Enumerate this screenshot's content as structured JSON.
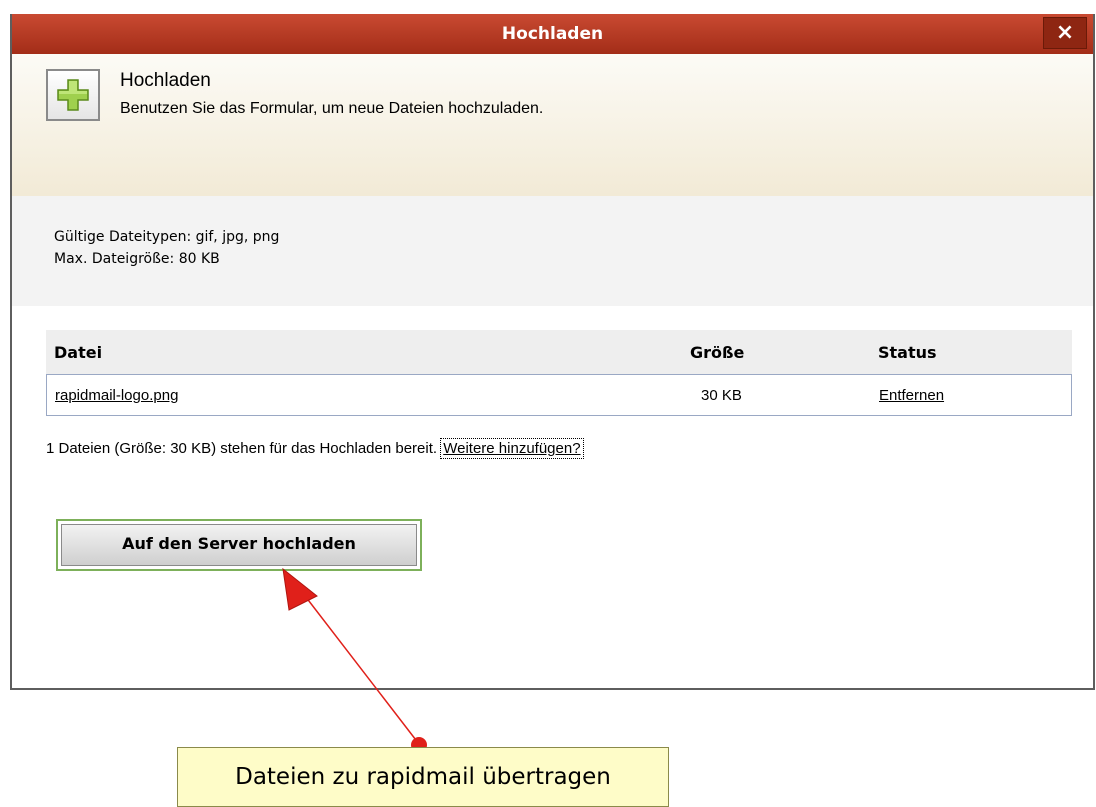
{
  "top_text": "",
  "dialog": {
    "title": "Hochladen",
    "close_label": "×",
    "header_title": "Hochladen",
    "header_subtitle": "Benutzen Sie das Formular, um neue Dateien hochzuladen.",
    "valid_types": "Gültige Dateitypen: gif, jpg, png",
    "max_size": "Max. Dateigröße: 80 KB",
    "table": {
      "columns": [
        "Datei",
        "Größe",
        "Status"
      ],
      "rows": [
        {
          "file": "rapidmail-logo.png",
          "size": "30 KB",
          "status": "Entfernen"
        }
      ]
    },
    "summary": "1 Dateien (Größe: 30 KB) stehen für das Hochladen bereit.",
    "add_more": "Weitere hinzufügen?",
    "upload_button": "Auf den Server hochladen"
  },
  "callout": "Dateien zu rapidmail übertragen",
  "colors": {
    "titlebar": "#b23a22",
    "arrow": "#e0201a",
    "callout_bg": "#fefcc8",
    "button_border": "#7db05a"
  },
  "icons": {
    "header_icon": "plus-icon",
    "close_icon": "close-icon"
  }
}
